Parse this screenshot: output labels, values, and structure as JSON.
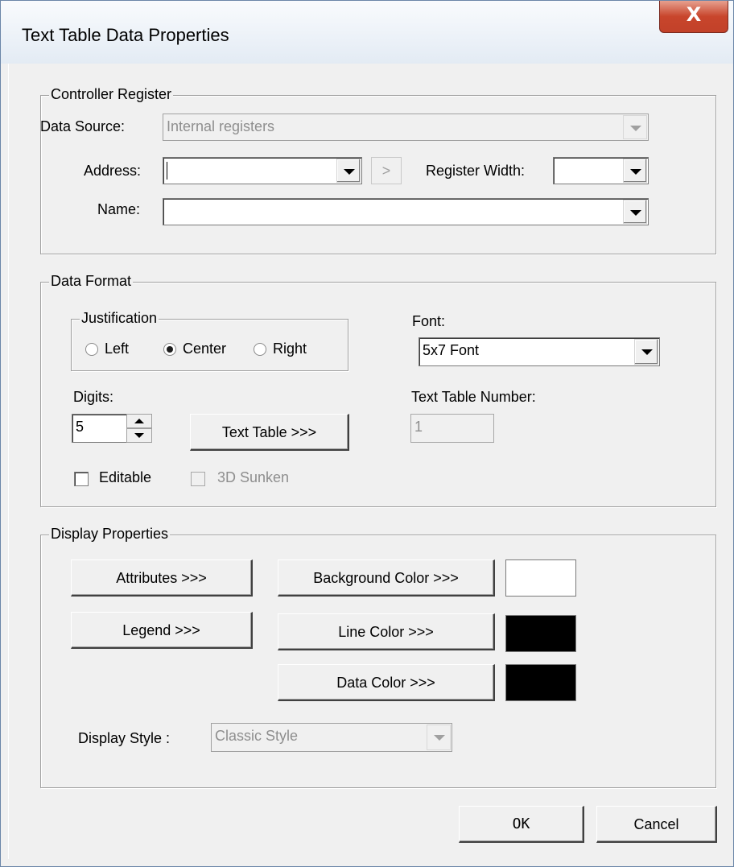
{
  "window": {
    "title": "Text Table Data Properties",
    "close_label": "X"
  },
  "controller_register": {
    "legend": "Controller Register",
    "data_source_label": "Data Source:",
    "data_source_value": "Internal registers",
    "address_label": "Address:",
    "address_value": "",
    "browse_label": ">",
    "register_width_label": "Register Width:",
    "register_width_value": "",
    "name_label": "Name:",
    "name_value": ""
  },
  "data_format": {
    "legend": "Data Format",
    "justification": {
      "legend": "Justification",
      "options": [
        "Left",
        "Center",
        "Right"
      ],
      "selected": "Center"
    },
    "font_label": "Font:",
    "font_value": "5x7 Font",
    "digits_label": "Digits:",
    "digits_value": "5",
    "text_table_button": "Text Table >>>",
    "text_table_number_label": "Text Table Number:",
    "text_table_number_value": "1",
    "editable_label": "Editable",
    "editable_checked": false,
    "sunken_label": "3D Sunken",
    "sunken_checked": false
  },
  "display_properties": {
    "legend": "Display Properties",
    "attributes_button": "Attributes >>>",
    "legend_button": "Legend >>>",
    "background_color_button": "Background Color >>>",
    "background_color": "#ffffff",
    "line_color_button": "Line Color >>>",
    "line_color": "#000000",
    "data_color_button": "Data Color >>>",
    "data_color": "#000000",
    "display_style_label": "Display Style :",
    "display_style_value": "Classic Style"
  },
  "footer": {
    "ok_label": "OK",
    "cancel_label": "Cancel"
  }
}
